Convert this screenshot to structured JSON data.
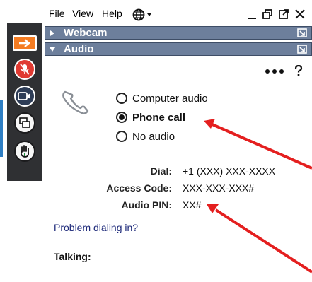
{
  "menubar": {
    "file": "File",
    "view": "View",
    "help": "Help"
  },
  "sections": {
    "webcam": "Webcam",
    "audio": "Audio"
  },
  "audio": {
    "options": [
      {
        "label": "Computer audio",
        "selected": false
      },
      {
        "label": "Phone call",
        "selected": true
      },
      {
        "label": "No audio",
        "selected": false
      }
    ],
    "dial_label": "Dial:",
    "dial_value": "+1 (XXX) XXX-XXXX",
    "access_label": "Access Code:",
    "access_value": "XXX-XXX-XXX#",
    "pin_label": "Audio PIN:",
    "pin_value": "XX#",
    "problem_link": "Problem dialing in?",
    "talking_label": "Talking:"
  },
  "colors": {
    "toolbar": "#2f3033",
    "section_bar": "#6d7f9c",
    "accent_orange": "#f57c22",
    "mic_red": "#e03a32",
    "annotation_arrow": "#e41f1f",
    "link": "#1e2a7a"
  },
  "icons": [
    "arrow-right-icon",
    "mic-muted-icon",
    "video-icon",
    "share-screen-icon",
    "raise-hand-icon",
    "globe-icon",
    "phone-icon",
    "more-icon",
    "help-icon"
  ]
}
